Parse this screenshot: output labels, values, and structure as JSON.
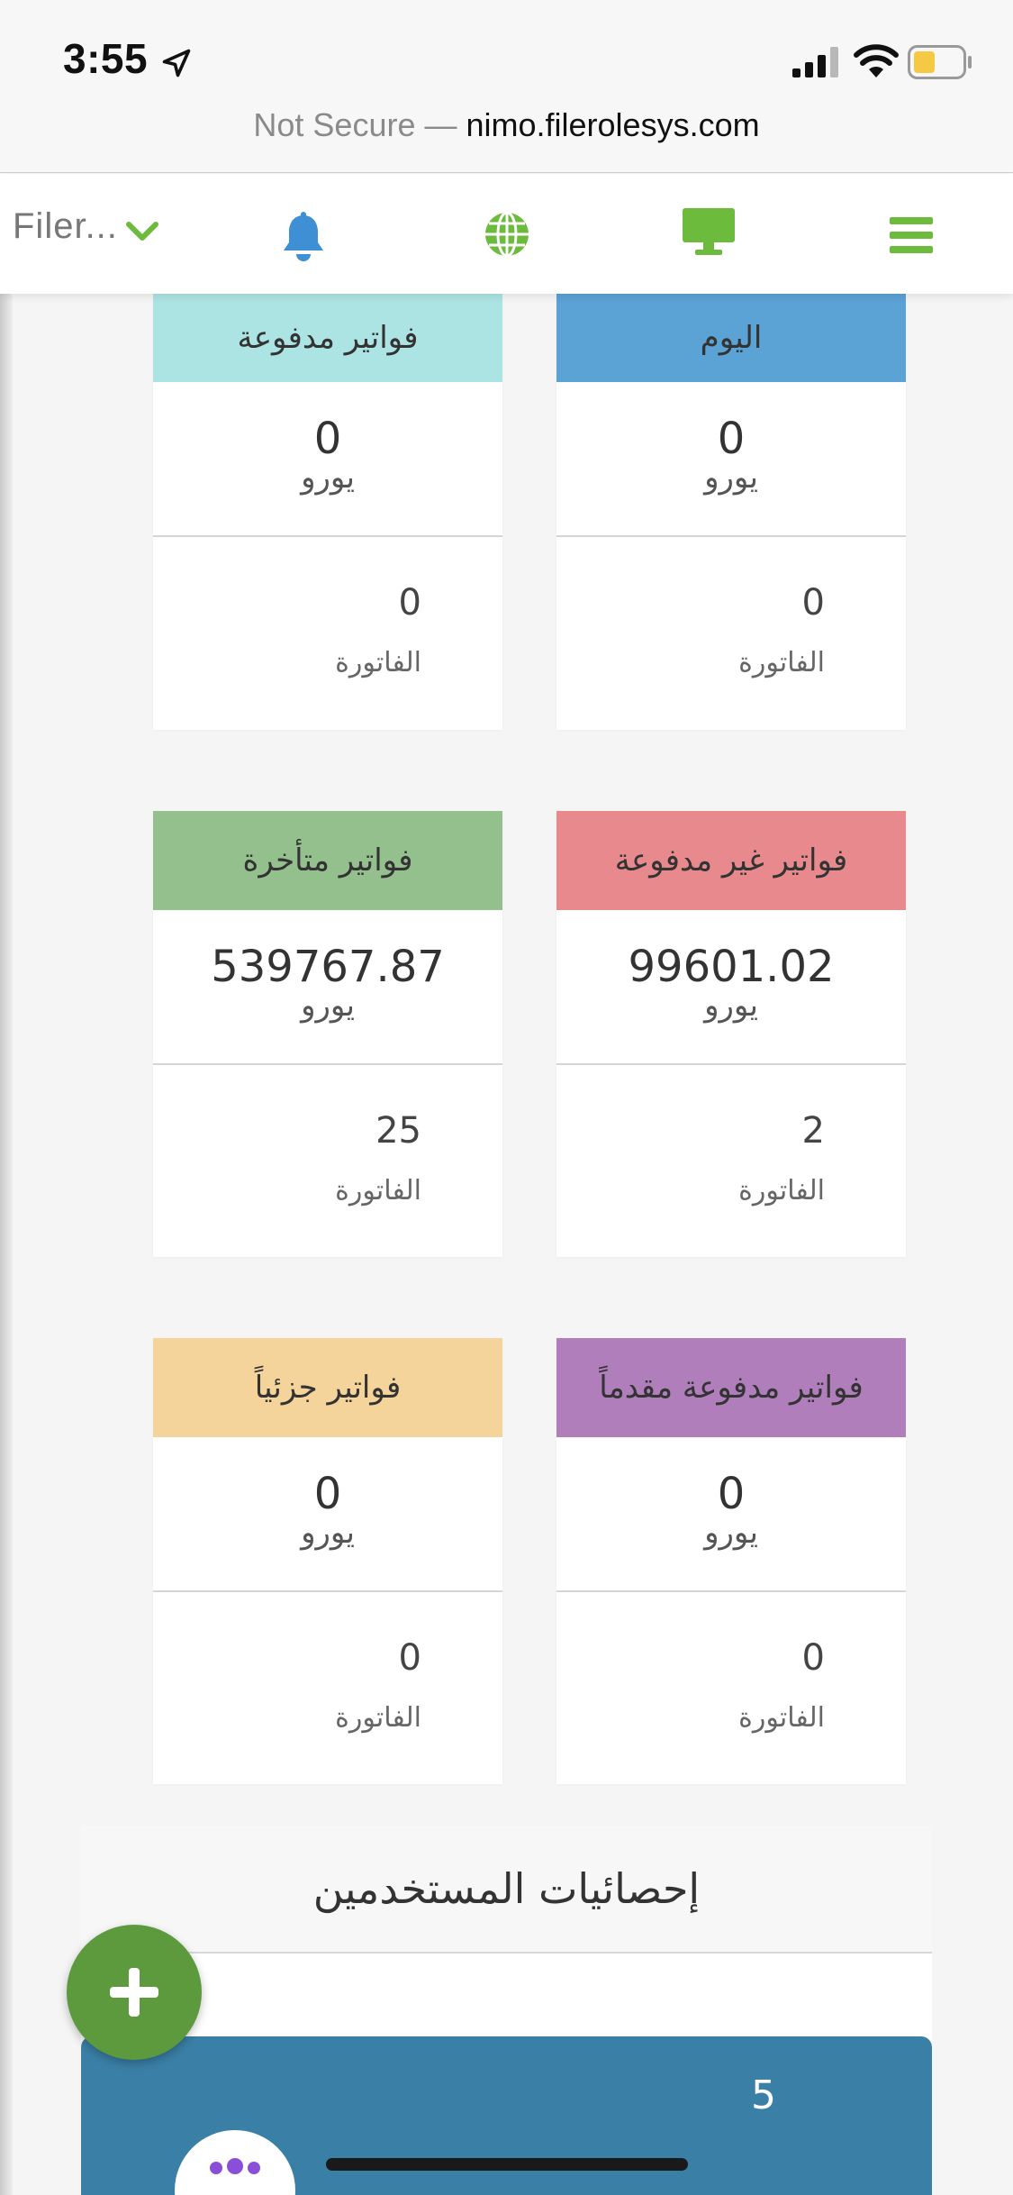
{
  "status_bar": {
    "time": "3:55",
    "url_insecure": "Not Secure —",
    "url_domain": "nimo.filerolesys.com",
    "icons": [
      "location-arrow-icon",
      "cellular-signal-icon",
      "wifi-icon",
      "battery-icon"
    ],
    "battery_level": 0.45,
    "battery_color": "#f6c945"
  },
  "header": {
    "brand": "Filer...",
    "icons": [
      "chevron-down-icon",
      "bell-icon",
      "globe-icon",
      "monitor-icon",
      "menu-icon"
    ],
    "accent_color": "#6dbb3c",
    "bell_color": "#3f8fd4"
  },
  "cards": [
    {
      "title": "فواتير مدفوعة",
      "amount": "0",
      "currency": "يورو",
      "count": "0",
      "count_label": "الفاتورة",
      "color": "#ace3e3"
    },
    {
      "title": "اليوم",
      "amount": "0",
      "currency": "يورو",
      "count": "0",
      "count_label": "الفاتورة",
      "color": "#5ba2d5"
    },
    {
      "title": "فواتير متأخرة",
      "amount": "539767.87",
      "currency": "يورو",
      "count": "25",
      "count_label": "الفاتورة",
      "color": "#94c08e"
    },
    {
      "title": "فواتير غير مدفوعة",
      "amount": "99601.02",
      "currency": "يورو",
      "count": "2",
      "count_label": "الفاتورة",
      "color": "#e88a8d"
    },
    {
      "title": "فواتير جزئياً",
      "amount": "0",
      "currency": "يورو",
      "count": "0",
      "count_label": "الفاتورة",
      "color": "#f4d49a"
    },
    {
      "title": "فواتير مدفوعة مقدماً",
      "amount": "0",
      "currency": "يورو",
      "count": "0",
      "count_label": "الفاتورة",
      "color": "#b07fbb"
    }
  ],
  "user_stats": {
    "title": "إحصائيات المستخدمين",
    "count": "5",
    "card_color": "#3a7fa6"
  },
  "fab": {
    "icon": "plus-icon",
    "color": "#5d9a3e"
  }
}
